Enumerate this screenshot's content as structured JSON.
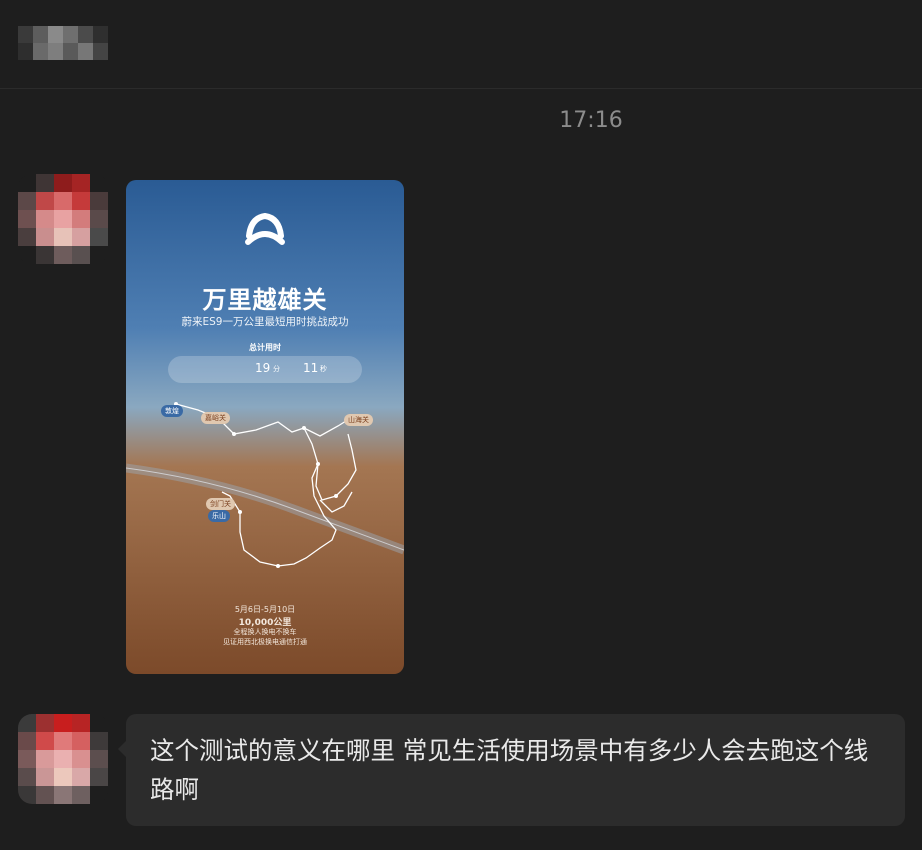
{
  "chat": {
    "timestamp": "17:16"
  },
  "messages": [
    {
      "type": "image",
      "poster": {
        "logo_icon": "nio-logo-icon",
        "title": "万里越雄关",
        "subtitle": "蔚来ES9一万公里最短用时挑战成功",
        "total_label": "总计用时",
        "minutes": "19",
        "minutes_unit": "分",
        "seconds": "11",
        "seconds_unit": "秒",
        "map_labels": {
          "dunhuang": "敦煌",
          "jiayuguan": "嘉峪关",
          "shanhaiguan": "山海关",
          "jianmenguan": "剑门关",
          "leshan": "乐山"
        },
        "dates": "5月6日-5月10日",
        "distance": "10,000公里",
        "line1": "全程换人换电不换车",
        "line2": "见证用西北极换电通信打通"
      }
    },
    {
      "type": "text",
      "text": "这个测试的意义在哪里 常见生活使用场景中有多少人会去跑这个线路啊"
    }
  ],
  "colors": {
    "background": "#1e1e1e",
    "bubble": "#2c2c2c",
    "timestamp": "#8c8c8c",
    "text": "#e9e9e9"
  }
}
